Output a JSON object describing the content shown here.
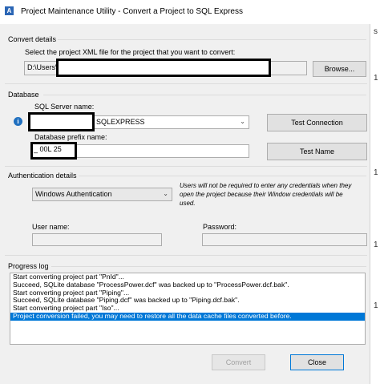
{
  "window": {
    "title": "Project Maintenance Utility - Convert a Project to SQL Express",
    "app_icon": "A"
  },
  "convert_details": {
    "section_label": "Convert details",
    "instruction": "Select the project XML file for the project that you want to convert:",
    "file_path_value": "D:\\Users\\",
    "browse_label": "Browse..."
  },
  "database": {
    "section_label": "Database",
    "server_name_label": "SQL Server name:",
    "server_name_value": "SQLEXPRESS",
    "test_connection_label": "Test Connection",
    "prefix_label": "Database prefix name:",
    "prefix_value": "_   00L   25",
    "test_name_label": "Test Name",
    "info_icon": "i"
  },
  "authentication": {
    "section_label": "Authentication details",
    "selected_mode": "Windows Authentication",
    "note": "Users will not be required to enter any credentials when they open the project because their Window credentials will be used.",
    "username_label": "User name:",
    "username_value": "",
    "password_label": "Password:",
    "password_value": ""
  },
  "progress_log": {
    "section_label": "Progress log",
    "lines": [
      "Start converting project part \"PnId\"...",
      "Succeed, SQLite database \"ProcessPower.dcf\" was backed up to \"ProcessPower.dcf.bak\".",
      "Start converting project part \"Piping\"...",
      "Succeed, SQLite database \"Piping.dcf\" was backed up to \"Piping.dcf.bak\".",
      "Start converting project part \"Iso\"...",
      "Project conversion failed, you may need to restore all the data cache files converted before."
    ],
    "selected_index": 5
  },
  "footer": {
    "convert_label": "Convert",
    "close_label": "Close"
  },
  "background_edge": {
    "glyph_top": "s",
    "numbers": [
      "1",
      "1",
      "1",
      "1"
    ]
  }
}
